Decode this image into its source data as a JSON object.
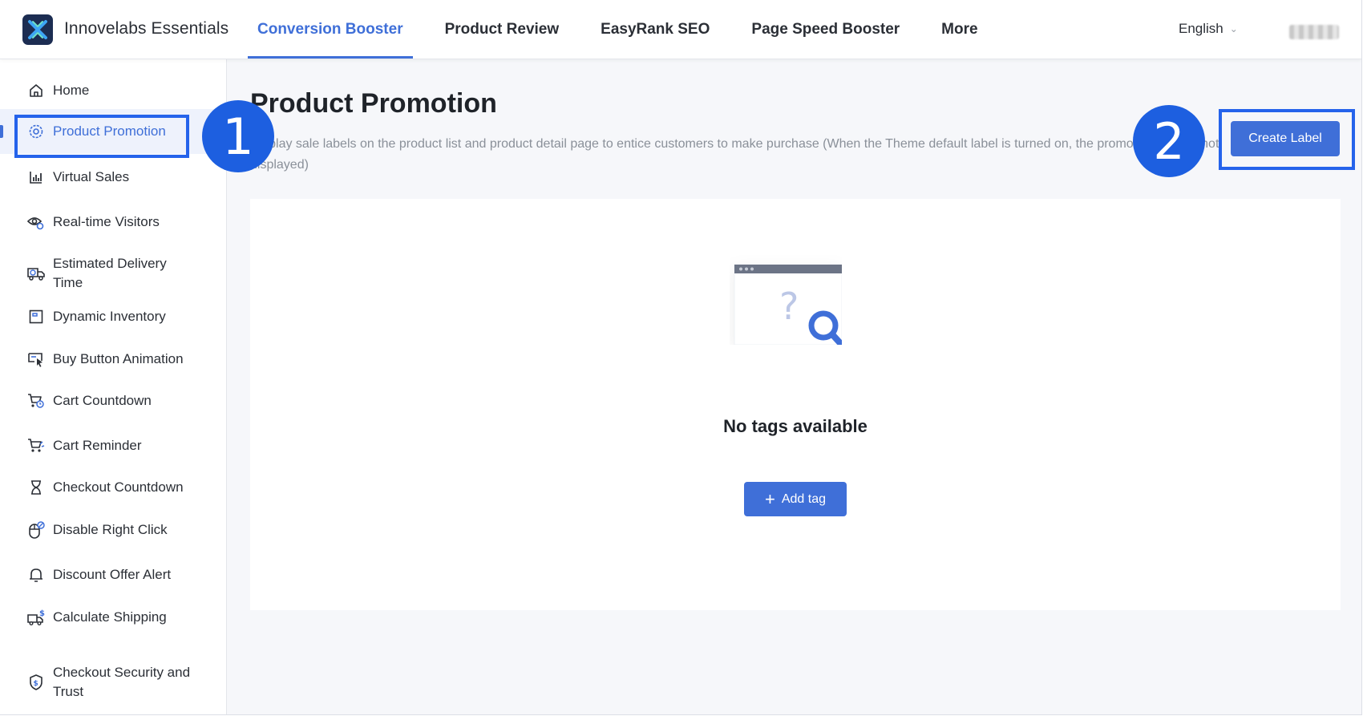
{
  "header": {
    "brand": "Innovelabs Essentials",
    "nav": [
      {
        "label": "Conversion Booster",
        "active": true
      },
      {
        "label": "Product Review"
      },
      {
        "label": "EasyRank SEO"
      },
      {
        "label": "Page Speed Booster"
      },
      {
        "label": "More"
      }
    ],
    "language": "English"
  },
  "sidebar": {
    "items": [
      {
        "label": "Home",
        "icon": "home-icon"
      },
      {
        "label": "Product Promotion",
        "icon": "gear-badge-icon",
        "active": true
      },
      {
        "label": "Virtual Sales",
        "icon": "bar-chart-icon"
      },
      {
        "label": "Real-time Visitors",
        "icon": "eye-icon"
      },
      {
        "label": "Estimated Delivery Time",
        "icon": "truck-icon"
      },
      {
        "label": "Dynamic Inventory",
        "icon": "inventory-icon"
      },
      {
        "label": "Buy Button Animation",
        "icon": "cursor-click-icon"
      },
      {
        "label": "Cart Countdown",
        "icon": "cart-clock-icon"
      },
      {
        "label": "Cart Reminder",
        "icon": "cart-reminder-icon"
      },
      {
        "label": "Checkout Countdown",
        "icon": "hourglass-icon"
      },
      {
        "label": "Disable Right Click",
        "icon": "mouse-icon"
      },
      {
        "label": "Discount Offer Alert",
        "icon": "bell-icon"
      },
      {
        "label": "Calculate Shipping",
        "icon": "shipping-dollar-icon"
      },
      {
        "label": "Checkout Security and Trust",
        "icon": "shield-dollar-icon"
      }
    ]
  },
  "main": {
    "title": "Product Promotion",
    "description": "Display sale labels on the product list and product detail page to entice customers to make purchase (When the Theme default label is turned on, the promotion label is not displayed)",
    "create_button": "Create Label",
    "empty_title": "No tags available",
    "add_button": "Add tag"
  },
  "annotations": {
    "badge1": "1",
    "badge2": "2"
  },
  "colors": {
    "accent": "#3f6fd8",
    "annotation": "#1d5fe0"
  }
}
